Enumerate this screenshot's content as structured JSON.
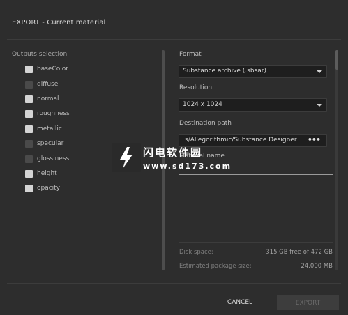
{
  "dialog": {
    "title": "EXPORT - Current material"
  },
  "outputs": {
    "label": "Outputs selection",
    "items": [
      {
        "label": "baseColor",
        "checked": true
      },
      {
        "label": "diffuse",
        "checked": false
      },
      {
        "label": "normal",
        "checked": true
      },
      {
        "label": "roughness",
        "checked": true
      },
      {
        "label": "metallic",
        "checked": true
      },
      {
        "label": "specular",
        "checked": false
      },
      {
        "label": "glossiness",
        "checked": false
      },
      {
        "label": "height",
        "checked": true
      },
      {
        "label": "opacity",
        "checked": true
      }
    ]
  },
  "format": {
    "label": "Format",
    "value": "Substance archive (.sbsar)"
  },
  "resolution": {
    "label": "Resolution",
    "value": "1024 x 1024"
  },
  "destination": {
    "label": "Destination path",
    "value": "s/Allegorithmic/Substance Designer",
    "browse": "•••"
  },
  "material_name": {
    "label": "Material name",
    "value": ""
  },
  "info": {
    "disk_space_label": "Disk space:",
    "disk_space_value": "315 GB free of 472 GB",
    "package_size_label": "Estimated package size:",
    "package_size_value": "24.000 MB"
  },
  "buttons": {
    "cancel": "CANCEL",
    "export": "EXPORT"
  },
  "watermark": {
    "line1": "闪电软件园",
    "line2": "www.sd173.com"
  },
  "colors": {
    "background": "#2d2d2d",
    "field": "#1e1e1e",
    "checked": "#d4d4d4",
    "unchecked": "#4a4a4a"
  }
}
